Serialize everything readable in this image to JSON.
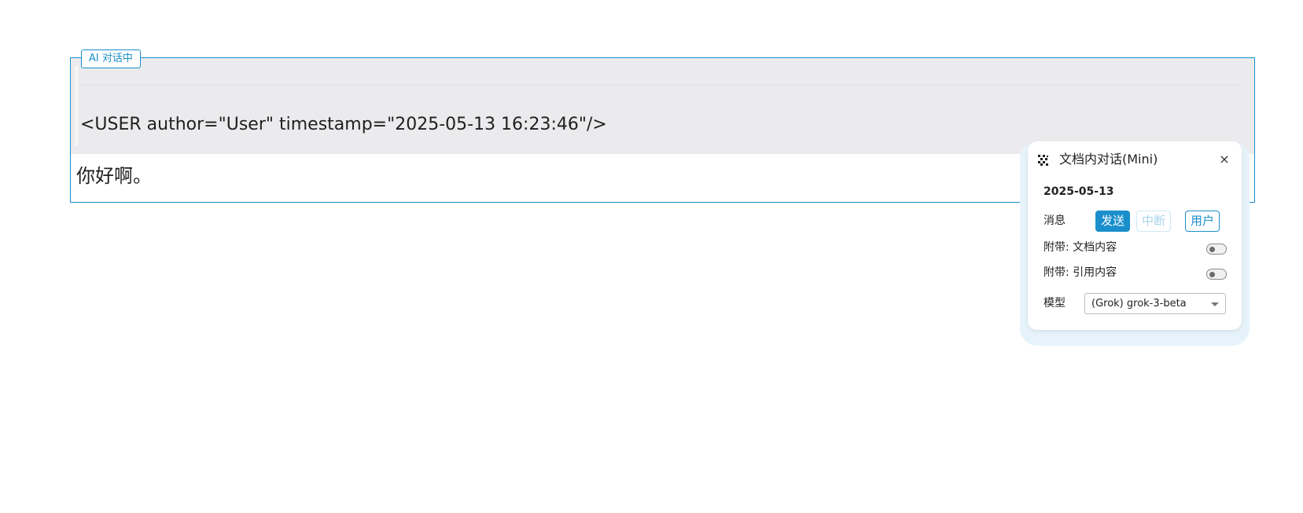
{
  "ai_block": {
    "tag_label": "AI 对话中",
    "user_line": "<USER author=\"User\" timestamp=\"2025-05-13 16:23:46\"/>",
    "message": "你好啊。"
  },
  "panel": {
    "icon": "chat-dots-icon",
    "title": "文档内对话(Mini)",
    "close_label": "×",
    "date": "2025-05-13",
    "message_label": "消息",
    "buttons": {
      "send": "发送",
      "stop": "中断",
      "user": "用户"
    },
    "toggles": [
      {
        "label": "附带: 文档内容",
        "on": false
      },
      {
        "label": "附带: 引用内容",
        "on": false
      }
    ],
    "model_label": "模型",
    "model_value": "(Grok) grok-3-beta"
  },
  "colors": {
    "accent": "#1a8fcc",
    "quote_bg": "#ebebed",
    "panel_glow": "#e6f3fa"
  }
}
